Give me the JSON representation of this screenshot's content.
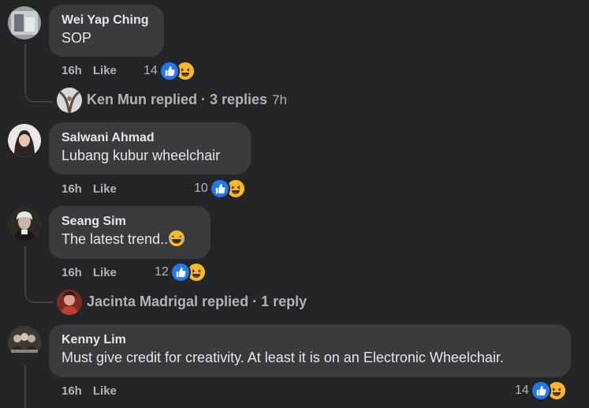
{
  "comments": [
    {
      "author": "Wei Yap Ching",
      "text": "SOP",
      "time": "16h",
      "like_label": "Like",
      "reaction_count": "14"
    },
    {
      "author": "Salwani Ahmad",
      "text": "Lubang kubur wheelchair",
      "time": "16h",
      "like_label": "Like",
      "reaction_count": "10"
    },
    {
      "author": "Seang Sim",
      "text": "The latest trend..",
      "time": "16h",
      "like_label": "Like",
      "reaction_count": "12"
    },
    {
      "author": "Kenny Lim",
      "text": "Must give credit for creativity. At least it is on an Electronic Wheelchair.",
      "time": "16h",
      "like_label": "Like",
      "reaction_count": "14"
    }
  ],
  "replies": [
    {
      "text": "Ken Mun replied · 3 replies",
      "time": "7h"
    },
    {
      "text": "Jacinta Madrigal replied · 1 reply",
      "time": ""
    }
  ],
  "icons": {
    "like": "thumbs-up-icon",
    "haha": "laughing-emoji-icon",
    "inline_emoji": "tears-of-joy-emoji-icon"
  },
  "colors": {
    "background": "#242526",
    "bubble": "#3a3b3c",
    "like_blue": "#2078f4",
    "haha_yellow": "#f7b928"
  }
}
